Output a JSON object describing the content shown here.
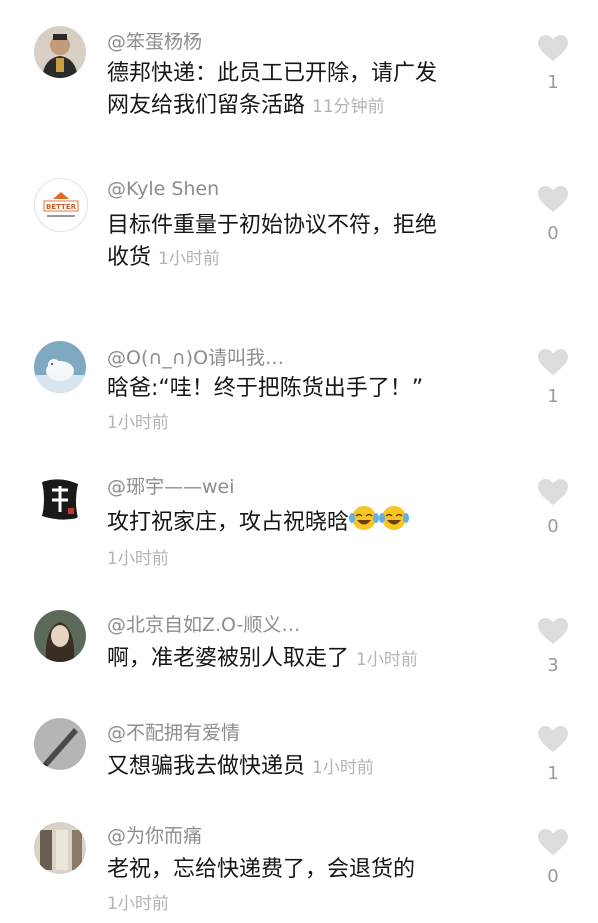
{
  "comments": [
    {
      "username": "@笨蛋杨杨",
      "line1": "德邦快递：此员工已开除，请广发",
      "line2": "网友给我们留条活路",
      "time": "11分钟前",
      "likes": "1",
      "avatar_color": "#5a4a3a"
    },
    {
      "username": "@Kyle Shen",
      "line1": "目标件重量于初始协议不符，拒绝",
      "line2": "收货",
      "time": "1小时前",
      "likes": "0",
      "avatar_color": "#ffffff",
      "avatar_text": "BETTER"
    },
    {
      "username": "@O(∩_∩)O请叫我…",
      "line1": "晗爸:“哇！终于把陈货出手了！”",
      "time": "1小时前",
      "likes": "1",
      "avatar_color": "#8fb5c8"
    },
    {
      "username": "@琊宇——wei",
      "line1": "攻打祝家庄，攻占祝晓晗",
      "time": "1小时前",
      "likes": "0",
      "avatar_color": "#ffffff"
    },
    {
      "username": "@北京自如Z.O-顺义…",
      "line1": "啊，准老婆被别人取走了",
      "time": "1小时前",
      "likes": "3",
      "avatar_color": "#6b6b5a"
    },
    {
      "username": "@不配拥有爱情",
      "line1": "又想骗我去做快递员",
      "time": "1小时前",
      "likes": "1",
      "avatar_color": "#9a9a9a"
    },
    {
      "username": "@为你而痛",
      "line1": "老祝，忘给快递费了，会退货的",
      "time": "1小时前",
      "likes": "0",
      "avatar_color": "#c9c0b0"
    }
  ],
  "icons": {
    "like": "heart-icon",
    "emoji": "laughing-crying-emoji-icon"
  },
  "colors": {
    "heart": "#dcdcdc",
    "username": "#8d8d8d",
    "time": "#b3b3b3",
    "text": "#161616"
  }
}
